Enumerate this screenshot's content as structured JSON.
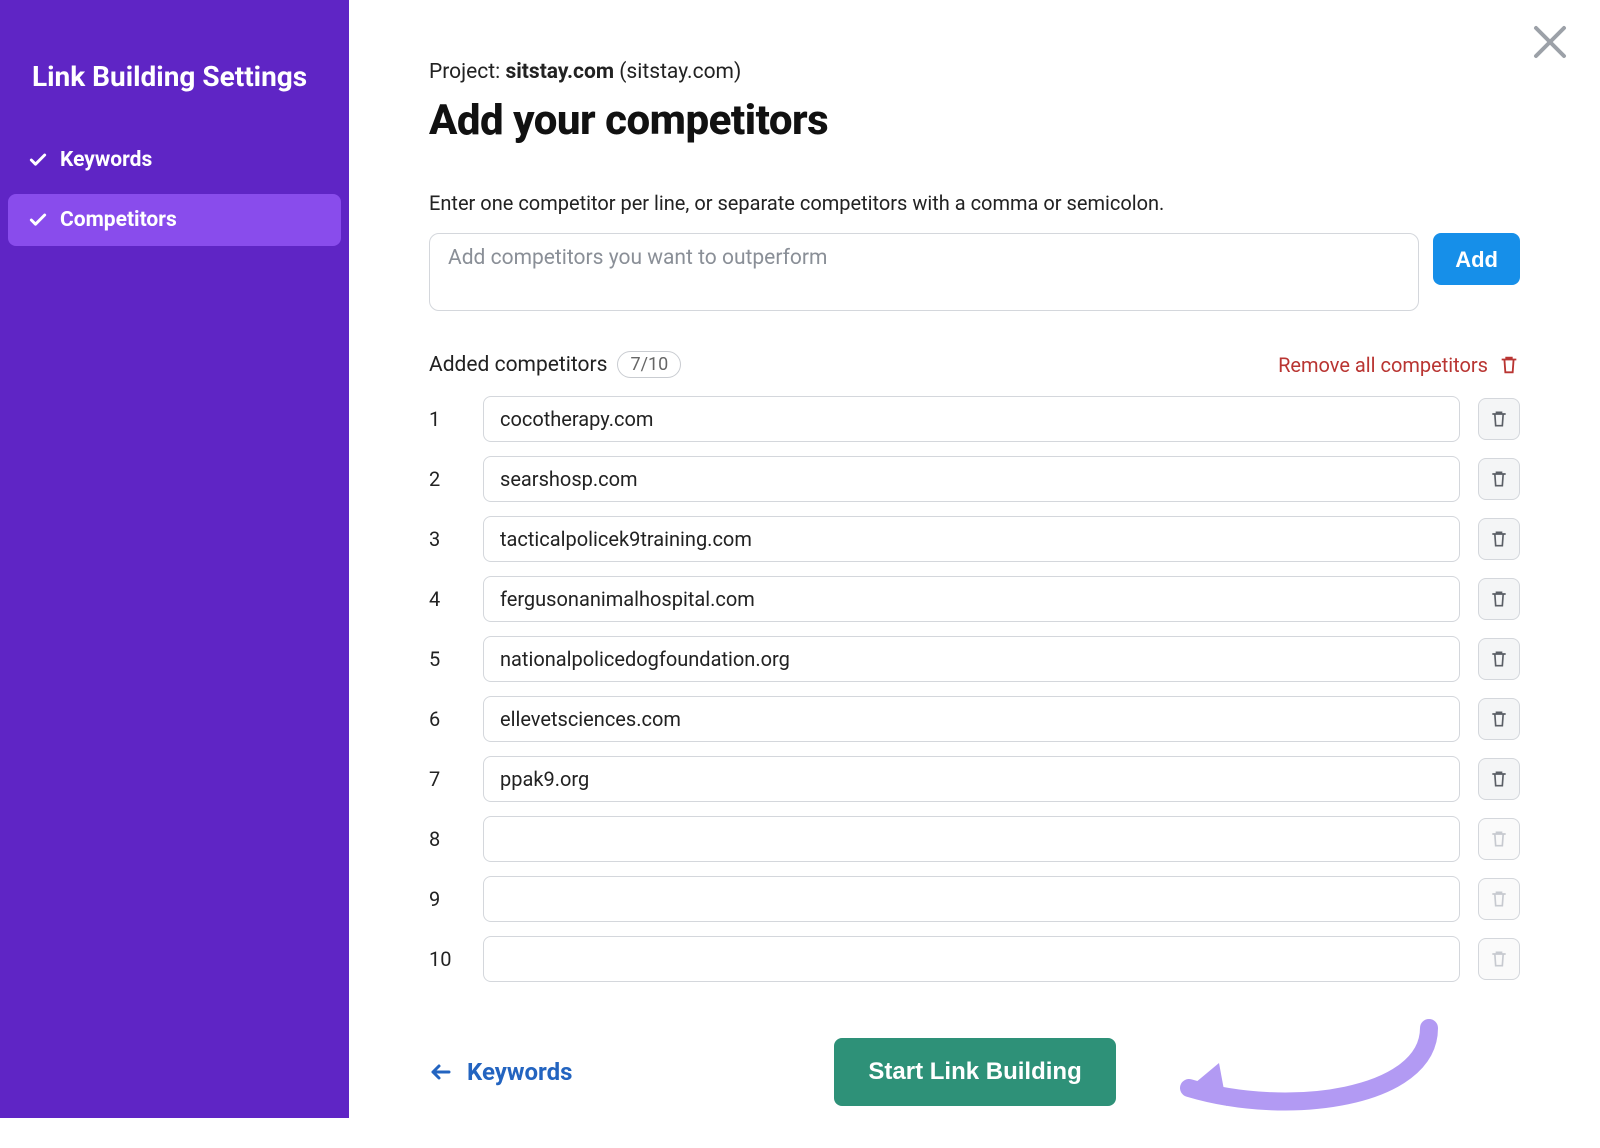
{
  "sidebar": {
    "title": "Link Building Settings",
    "items": [
      {
        "label": "Keywords",
        "active": false
      },
      {
        "label": "Competitors",
        "active": true
      }
    ]
  },
  "project": {
    "prefix": "Project: ",
    "name": "sitstay.com",
    "suffix": " (sitstay.com)"
  },
  "heading": "Add your competitors",
  "instructions": "Enter one competitor per line, or separate competitors with a comma or semicolon.",
  "input": {
    "placeholder": "Add competitors you want to outperform",
    "add_label": "Add"
  },
  "added": {
    "label": "Added competitors",
    "count": "7/10",
    "remove_all_label": "Remove all competitors"
  },
  "competitors": [
    "cocotherapy.com",
    "searshosp.com",
    "tacticalpolicek9training.com",
    "fergusonanimalhospital.com",
    "nationalpolicedogfoundation.org",
    "ellevetsciences.com",
    "ppak9.org",
    "",
    "",
    ""
  ],
  "footer": {
    "back_label": "Keywords",
    "start_label": "Start Link Building"
  }
}
